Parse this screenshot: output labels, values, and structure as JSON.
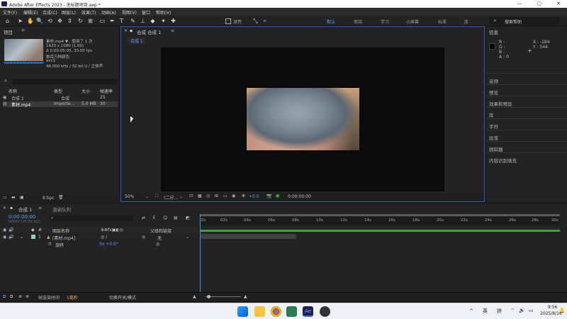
{
  "window": {
    "title": "Adobe After Effects 2023 - 无标题项目.aep *",
    "minimize": "—",
    "maximize": "▢",
    "close": "✕"
  },
  "menu": [
    "文件(F)",
    "编辑(E)",
    "合成(C)",
    "图层(L)",
    "效果(T)",
    "动画(A)",
    "视图(V)",
    "窗口",
    "帮助(H)"
  ],
  "toolbar": {
    "align_label": "对齐",
    "workspaces": [
      "默认",
      "审阅",
      "学习",
      "小屏幕",
      "标准",
      "库"
    ],
    "active_workspace": "默认",
    "search_placeholder": "搜索帮助"
  },
  "project": {
    "title": "项目",
    "file_name": "素材.mp4 ▼ , 使用了 1 次",
    "resolution": "1920 x 1080 (1.00)",
    "duration": "Δ 0:00:05:05, 30.00 fps",
    "colors": "数百万种颜色",
    "codec": "avc1",
    "audio": "48.000 kHz / 32 bit U / 立体声",
    "col_name": "名称",
    "col_type": "类型",
    "col_size": "大小",
    "col_rate": "帧速率",
    "items": [
      {
        "name": "合成 1",
        "type": "合成",
        "size": "",
        "rate": "25"
      },
      {
        "name": "素材.mp4",
        "type": "Importe...",
        "size": "5.0 MB",
        "rate": "30"
      }
    ],
    "bpc": "8 bpc"
  },
  "viewer": {
    "tab": "合成 合成 1",
    "breadcrumb": "合成 1",
    "zoom": "50%",
    "resolution": "(二分...",
    "exposure": "+0.0",
    "timecode": "0:00:00:00"
  },
  "info": {
    "title": "信息",
    "r": "R :",
    "g": "G :",
    "b": "B :",
    "a": "A : 0",
    "x": "X : -184",
    "y": "Y : 544",
    "sections": [
      "音频",
      "预览",
      "效果和预设",
      "库",
      "字符",
      "段落",
      "跟踪器",
      "内容识别填充"
    ]
  },
  "timeline": {
    "tab": "合成 1",
    "render_queue": "渲染队列",
    "timecode": "0:00:00:00",
    "frame_info": "00000 (25.00 fps)",
    "col_layer": "图层名称",
    "col_parent": "父级和链接",
    "layer_number": "1",
    "layer_name": "[素材.mp4]",
    "parent_value": "无",
    "transform_label": "旋转",
    "transform_value": "0x +0.0°",
    "ticks": [
      "0s",
      "02s",
      "04s",
      "06s",
      "08s",
      "10s",
      "12s",
      "14s",
      "16s",
      "18s",
      "20s",
      "22s",
      "24s",
      "26s",
      "28s",
      "30s"
    ]
  },
  "status": {
    "render_time_label": "帧渲染时间",
    "render_time_value": "1毫秒",
    "toggle_label": "切换开关/模式"
  },
  "taskbar": {
    "lang1": "英",
    "lang2": "拼",
    "time": "9:56",
    "date": "2025/8/18"
  }
}
